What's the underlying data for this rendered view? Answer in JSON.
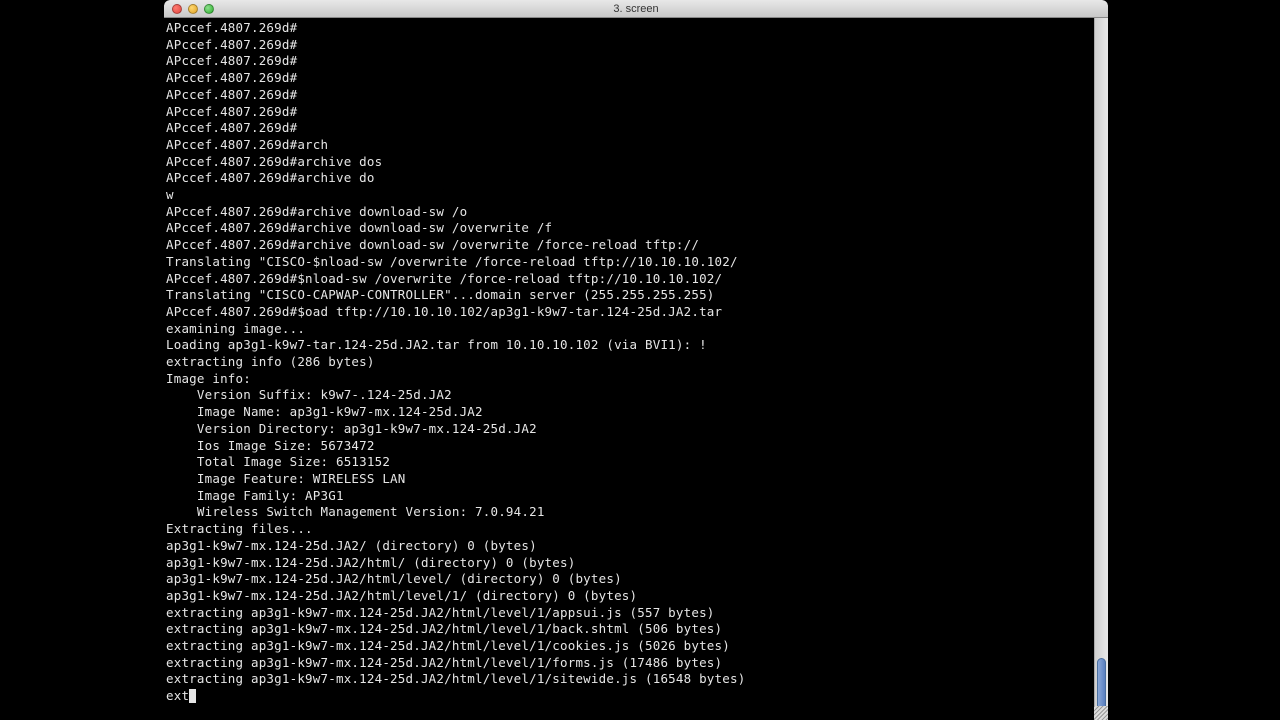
{
  "window": {
    "title": "3. screen"
  },
  "terminal": {
    "lines": [
      "APccef.4807.269d#",
      "APccef.4807.269d#",
      "APccef.4807.269d#",
      "APccef.4807.269d#",
      "APccef.4807.269d#",
      "APccef.4807.269d#",
      "APccef.4807.269d#",
      "APccef.4807.269d#arch",
      "APccef.4807.269d#archive dos",
      "APccef.4807.269d#archive do",
      "w",
      "APccef.4807.269d#archive download-sw /o",
      "APccef.4807.269d#archive download-sw /overwrite /f",
      "APccef.4807.269d#archive download-sw /overwrite /force-reload tftp://",
      "Translating \"CISCO-$nload-sw /overwrite /force-reload tftp://10.10.10.102/",
      "",
      "APccef.4807.269d#$nload-sw /overwrite /force-reload tftp://10.10.10.102/",
      "Translating \"CISCO-CAPWAP-CONTROLLER\"...domain server (255.255.255.255)",
      "APccef.4807.269d#$oad tftp://10.10.10.102/ap3g1-k9w7-tar.124-25d.JA2.tar",
      "examining image...",
      "Loading ap3g1-k9w7-tar.124-25d.JA2.tar from 10.10.10.102 (via BVI1): !",
      "extracting info (286 bytes)",
      "Image info:",
      "    Version Suffix: k9w7-.124-25d.JA2",
      "    Image Name: ap3g1-k9w7-mx.124-25d.JA2",
      "    Version Directory: ap3g1-k9w7-mx.124-25d.JA2",
      "    Ios Image Size: 5673472",
      "    Total Image Size: 6513152",
      "    Image Feature: WIRELESS LAN",
      "    Image Family: AP3G1",
      "    Wireless Switch Management Version: 7.0.94.21",
      "Extracting files...",
      "ap3g1-k9w7-mx.124-25d.JA2/ (directory) 0 (bytes)",
      "ap3g1-k9w7-mx.124-25d.JA2/html/ (directory) 0 (bytes)",
      "ap3g1-k9w7-mx.124-25d.JA2/html/level/ (directory) 0 (bytes)",
      "ap3g1-k9w7-mx.124-25d.JA2/html/level/1/ (directory) 0 (bytes)",
      "extracting ap3g1-k9w7-mx.124-25d.JA2/html/level/1/appsui.js (557 bytes)",
      "extracting ap3g1-k9w7-mx.124-25d.JA2/html/level/1/back.shtml (506 bytes)",
      "extracting ap3g1-k9w7-mx.124-25d.JA2/html/level/1/cookies.js (5026 bytes)",
      "extracting ap3g1-k9w7-mx.124-25d.JA2/html/level/1/forms.js (17486 bytes)",
      "extracting ap3g1-k9w7-mx.124-25d.JA2/html/level/1/sitewide.js (16548 bytes)"
    ],
    "current_input": "ext"
  }
}
